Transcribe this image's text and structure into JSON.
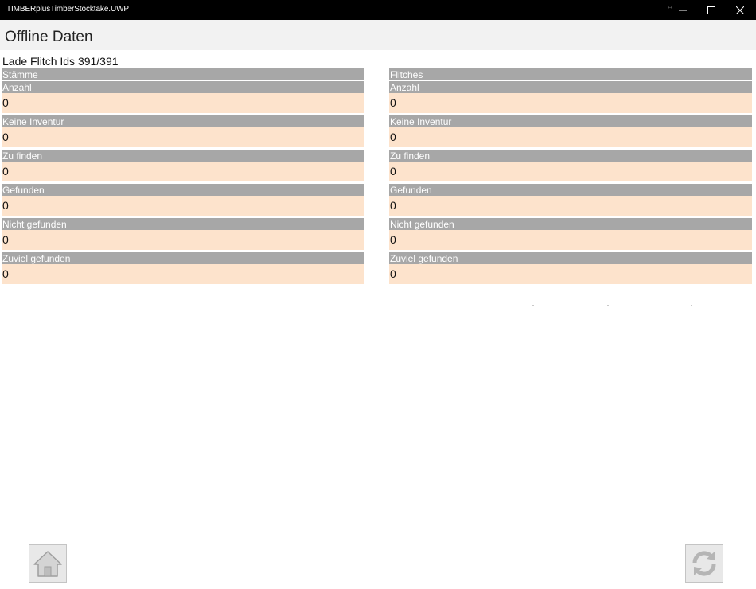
{
  "window": {
    "title": "TIMBERplusTimberStocktake.UWP"
  },
  "header": {
    "title": "Offline Daten"
  },
  "status": "Lade Flitch Ids 391/391",
  "columns": [
    {
      "title": "Stämme",
      "stats": [
        {
          "label": "Anzahl",
          "value": "0"
        },
        {
          "label": "Keine Inventur",
          "value": "0"
        },
        {
          "label": "Zu finden",
          "value": "0"
        },
        {
          "label": "Gefunden",
          "value": "0"
        },
        {
          "label": "Nicht gefunden",
          "value": "0"
        },
        {
          "label": "Zuviel gefunden",
          "value": "0"
        }
      ]
    },
    {
      "title": "Flitches",
      "stats": [
        {
          "label": "Anzahl",
          "value": "0"
        },
        {
          "label": "Keine Inventur",
          "value": "0"
        },
        {
          "label": "Zu finden",
          "value": "0"
        },
        {
          "label": "Gefunden",
          "value": "0"
        },
        {
          "label": "Nicht gefunden",
          "value": "0"
        },
        {
          "label": "Zuviel gefunden",
          "value": "0"
        }
      ]
    }
  ],
  "icons": {
    "resize": "resize-arrows-icon",
    "minimize": "minimize-icon",
    "maximize": "maximize-icon",
    "close": "close-icon",
    "home": "home-icon",
    "refresh": "refresh-icon"
  },
  "colors": {
    "titlebar": "#000000",
    "header_bg": "#f2f2f2",
    "label_bg": "#a7a7a7",
    "value_bg": "#fde3cc"
  }
}
